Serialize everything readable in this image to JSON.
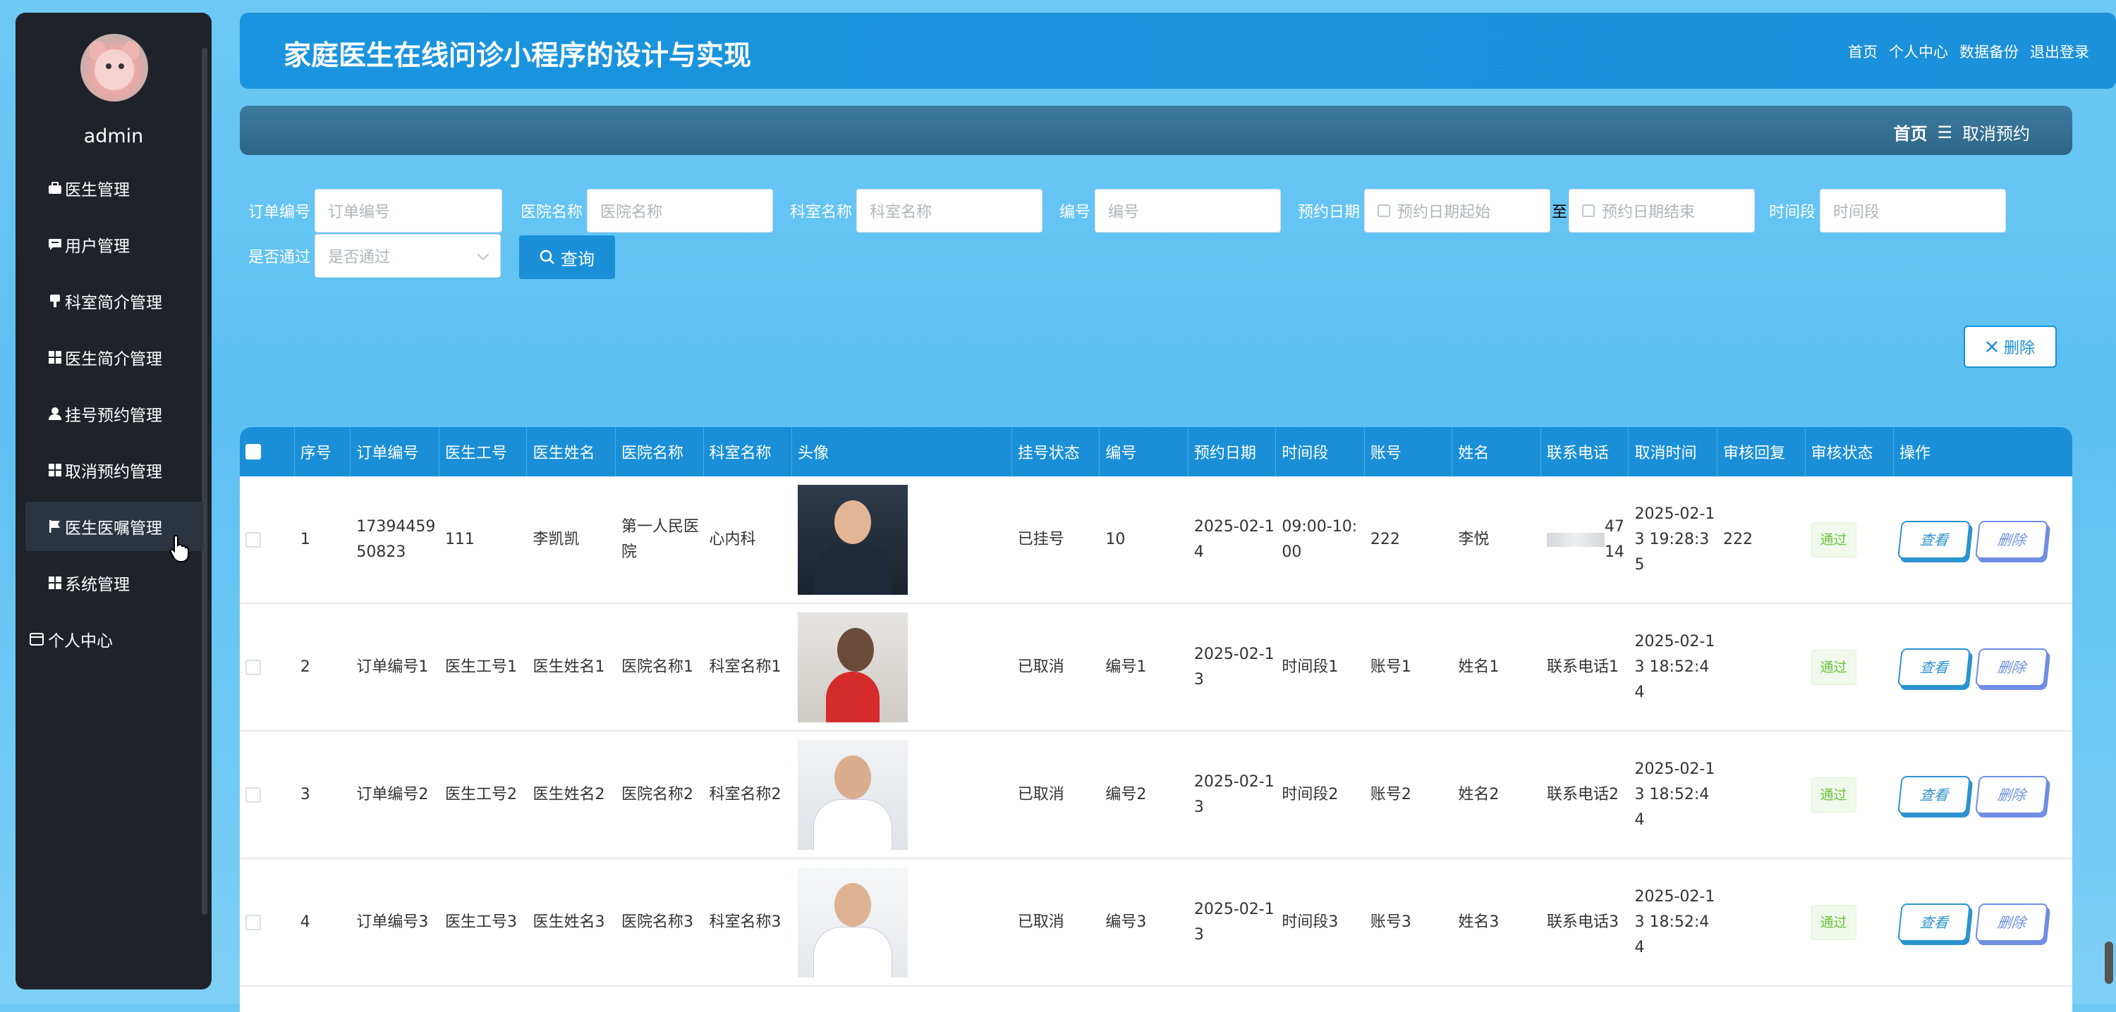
{
  "sidebar": {
    "username": "admin",
    "items": [
      {
        "label": "医生管理",
        "icon": "briefcase-icon"
      },
      {
        "label": "用户管理",
        "icon": "chat-icon"
      },
      {
        "label": "科室简介管理",
        "icon": "pin-icon"
      },
      {
        "label": "医生简介管理",
        "icon": "grid-icon"
      },
      {
        "label": "挂号预约管理",
        "icon": "user-icon"
      },
      {
        "label": "取消预约管理",
        "icon": "grid-icon"
      },
      {
        "label": "医生医嘱管理",
        "icon": "flag-icon"
      },
      {
        "label": "系统管理",
        "icon": "grid-icon"
      }
    ],
    "personal": "个人中心"
  },
  "header": {
    "title": "家庭医生在线问诊小程序的设计与实现",
    "links": [
      "首页",
      "个人中心",
      "数据备份",
      "退出登录"
    ]
  },
  "breadcrumb": {
    "home": "首页",
    "separator": "☰",
    "current": "取消预约"
  },
  "search": {
    "fields": [
      {
        "label": "订单编号",
        "placeholder": "订单编号"
      },
      {
        "label": "医院名称",
        "placeholder": "医院名称"
      },
      {
        "label": "科室名称",
        "placeholder": "科室名称"
      },
      {
        "label": "编号",
        "placeholder": "编号"
      },
      {
        "label": "预约日期",
        "placeholder": "预约日期起始"
      },
      {
        "label": "至",
        "placeholder": "预约日期结束"
      },
      {
        "label": "时间段",
        "placeholder": "时间段"
      },
      {
        "label": "是否通过",
        "placeholder": "是否通过"
      }
    ],
    "query_button": "查询",
    "delete_button": "删除"
  },
  "table": {
    "columns": [
      "序号",
      "订单编号",
      "医生工号",
      "医生姓名",
      "医院名称",
      "科室名称",
      "头像",
      "挂号状态",
      "编号",
      "预约日期",
      "时间段",
      "账号",
      "姓名",
      "联系电话",
      "取消时间",
      "审核回复",
      "审核状态",
      "操作"
    ],
    "rows": [
      {
        "no": "1",
        "order": "1739445950823",
        "doc_id": "111",
        "doc_name": "李凯凯",
        "hospital": "第一人民医院",
        "dept": "心内科",
        "status": "已挂号",
        "code": "10",
        "date": "2025-02-14",
        "time": "09:00-10:00",
        "account": "222",
        "name": "李悦",
        "phone": "47\n14",
        "cancel_time": "2025-02-13 19:28:35",
        "reply": "222",
        "audit": "通过"
      },
      {
        "no": "2",
        "order": "订单编号1",
        "doc_id": "医生工号1",
        "doc_name": "医生姓名1",
        "hospital": "医院名称1",
        "dept": "科室名称1",
        "status": "已取消",
        "code": "编号1",
        "date": "2025-02-13",
        "time": "时间段1",
        "account": "账号1",
        "name": "姓名1",
        "phone": "联系电话1",
        "cancel_time": "2025-02-13 18:52:44",
        "reply": "",
        "audit": "通过"
      },
      {
        "no": "3",
        "order": "订单编号2",
        "doc_id": "医生工号2",
        "doc_name": "医生姓名2",
        "hospital": "医院名称2",
        "dept": "科室名称2",
        "status": "已取消",
        "code": "编号2",
        "date": "2025-02-13",
        "time": "时间段2",
        "account": "账号2",
        "name": "姓名2",
        "phone": "联系电话2",
        "cancel_time": "2025-02-13 18:52:44",
        "reply": "",
        "audit": "通过"
      },
      {
        "no": "4",
        "order": "订单编号3",
        "doc_id": "医生工号3",
        "doc_name": "医生姓名3",
        "hospital": "医院名称3",
        "dept": "科室名称3",
        "status": "已取消",
        "code": "编号3",
        "date": "2025-02-13",
        "time": "时间段3",
        "account": "账号3",
        "name": "姓名3",
        "phone": "联系电话3",
        "cancel_time": "2025-02-13 18:52:44",
        "reply": "",
        "audit": "通过"
      }
    ],
    "view_label": "查看",
    "delete_label": "删除"
  },
  "colors": {
    "primary": "#1a8fd8",
    "sidebar": "#1f2329",
    "success": "#67c23a"
  }
}
